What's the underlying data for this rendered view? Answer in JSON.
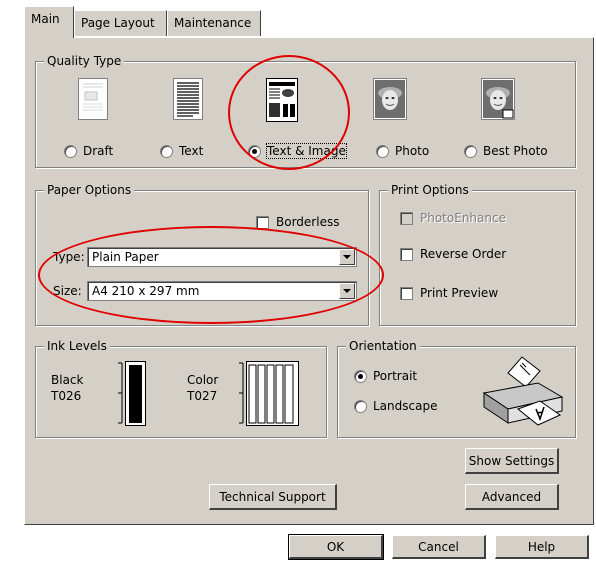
{
  "tabs": [
    {
      "label": "Main",
      "active": true
    },
    {
      "label": "Page Layout",
      "active": false
    },
    {
      "label": "Maintenance",
      "active": false
    }
  ],
  "quality_type": {
    "title": "Quality Type",
    "options": [
      {
        "label": "Draft",
        "selected": false,
        "icon": "draft-page-icon"
      },
      {
        "label": "Text",
        "selected": false,
        "icon": "text-page-icon"
      },
      {
        "label": "Text & Image",
        "selected": true,
        "icon": "text-image-page-icon"
      },
      {
        "label": "Photo",
        "selected": false,
        "icon": "photo-page-icon"
      },
      {
        "label": "Best Photo",
        "selected": false,
        "icon": "best-photo-page-icon"
      }
    ]
  },
  "paper_options": {
    "title": "Paper Options",
    "borderless_label": "Borderless",
    "type_label": "Type:",
    "type_value": "Plain Paper",
    "size_label": "Size:",
    "size_value": "A4 210 x 297 mm"
  },
  "print_options": {
    "title": "Print Options",
    "photo_enhance": "PhotoEnhance",
    "reverse_order": "Reverse Order",
    "print_preview": "Print Preview"
  },
  "ink_levels": {
    "title": "Ink Levels",
    "black_label": "Black",
    "black_code": "T026",
    "color_label": "Color",
    "color_code": "T027"
  },
  "orientation": {
    "title": "Orientation",
    "portrait": "Portrait",
    "landscape": "Landscape",
    "selected": "Portrait"
  },
  "buttons": {
    "show_settings": "Show Settings",
    "technical_support": "Technical Support",
    "advanced": "Advanced",
    "ok": "OK",
    "cancel": "Cancel",
    "help": "Help"
  },
  "colors": {
    "dialog_bg": "#d4d0c8",
    "annotation_red": "#e00000"
  }
}
